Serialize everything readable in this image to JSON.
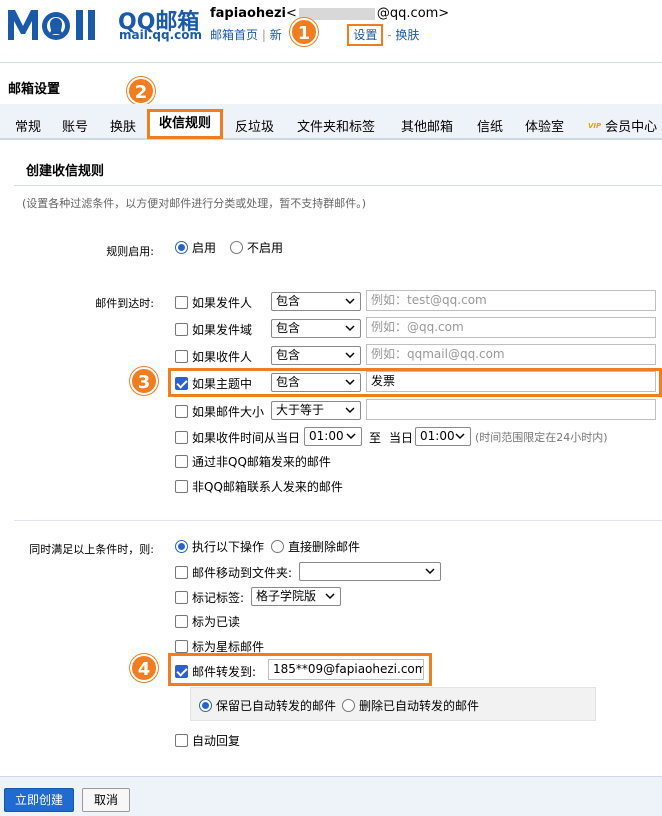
{
  "header": {
    "logo_brand": "QQ邮箱",
    "logo_domain": "mail.qq.com",
    "user_name": "fapiaohezi",
    "email_prefix": "<",
    "email_suffix": "@qq.com>",
    "nav_home": "邮箱首页",
    "nav_sep1": "|",
    "nav_new_partial": "新",
    "nav_settings": "设置",
    "nav_sep2": "-",
    "nav_skin": "换肤"
  },
  "steps": [
    "1",
    "2",
    "3",
    "4"
  ],
  "page_title": "邮箱设置",
  "tabs": [
    {
      "label": "常规"
    },
    {
      "label": "账号"
    },
    {
      "label": "换肤"
    },
    {
      "label": "收信规则"
    },
    {
      "label": "反垃圾"
    },
    {
      "label": "文件夹和标签"
    },
    {
      "label": "其他邮箱"
    },
    {
      "label": "信纸"
    },
    {
      "label": "体验室"
    },
    {
      "label": "会员中心"
    }
  ],
  "vip_badge": "VIP",
  "rule": {
    "title": "创建收信规则",
    "description": "(设置各种过滤条件，以方便对邮件进行分类或处理，暂不支持群邮件。)",
    "enable_label": "规则启用:",
    "enable_on": "启用",
    "enable_off": "不启用",
    "arrival_label": "邮件到达时:",
    "conditions": [
      {
        "label": "如果发件人",
        "op": "包含",
        "placeholder": "例如：test@qq.com",
        "checked": false
      },
      {
        "label": "如果发件域",
        "op": "包含",
        "placeholder": "例如：@qq.com",
        "checked": false
      },
      {
        "label": "如果收件人",
        "op": "包含",
        "placeholder": "例如：qqmail@qq.com",
        "checked": false
      },
      {
        "label": "如果主题中",
        "op": "包含",
        "value": "发票",
        "checked": true
      },
      {
        "label": "如果邮件大小",
        "op": "大于等于",
        "value": "",
        "checked": false
      }
    ],
    "time": {
      "label": "如果收件时间从当日",
      "from": "01:00",
      "to_label": "至",
      "day_label": "当日",
      "to": "01:00",
      "note": "(时间范围限定在24小时内)"
    },
    "via_non_qq": "通过非QQ邮箱发来的邮件",
    "non_contact": "非QQ邮箱联系人发来的邮件",
    "action_label": "同时满足以上条件时，则:",
    "action_exec": "执行以下操作",
    "action_delete": "直接删除邮件",
    "actions": {
      "move_folder": "邮件移动到文件夹:",
      "mark_tag": "标记标签:",
      "tag_value": "格子学院版",
      "mark_read": "标为已读",
      "mark_star": "标为星标邮件",
      "forward": "邮件转发到:",
      "forward_to": "185**09@fapiaohezi.com",
      "keep_forwarded": "保留已自动转发的邮件",
      "delete_forwarded": "删除已自动转发的邮件",
      "auto_reply": "自动回复"
    }
  },
  "footer": {
    "create": "立即创建",
    "cancel": "取消"
  }
}
